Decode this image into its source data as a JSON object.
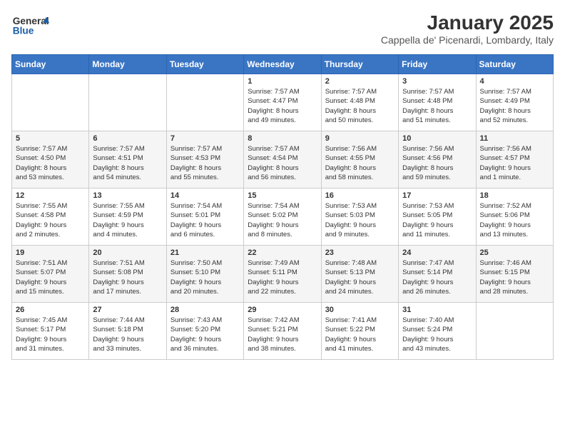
{
  "header": {
    "logo_general": "General",
    "logo_blue": "Blue",
    "title": "January 2025",
    "subtitle": "Cappella de' Picenardi, Lombardy, Italy"
  },
  "weekdays": [
    "Sunday",
    "Monday",
    "Tuesday",
    "Wednesday",
    "Thursday",
    "Friday",
    "Saturday"
  ],
  "weeks": [
    [
      {
        "day": "",
        "info": ""
      },
      {
        "day": "",
        "info": ""
      },
      {
        "day": "",
        "info": ""
      },
      {
        "day": "1",
        "info": "Sunrise: 7:57 AM\nSunset: 4:47 PM\nDaylight: 8 hours\nand 49 minutes."
      },
      {
        "day": "2",
        "info": "Sunrise: 7:57 AM\nSunset: 4:48 PM\nDaylight: 8 hours\nand 50 minutes."
      },
      {
        "day": "3",
        "info": "Sunrise: 7:57 AM\nSunset: 4:48 PM\nDaylight: 8 hours\nand 51 minutes."
      },
      {
        "day": "4",
        "info": "Sunrise: 7:57 AM\nSunset: 4:49 PM\nDaylight: 8 hours\nand 52 minutes."
      }
    ],
    [
      {
        "day": "5",
        "info": "Sunrise: 7:57 AM\nSunset: 4:50 PM\nDaylight: 8 hours\nand 53 minutes."
      },
      {
        "day": "6",
        "info": "Sunrise: 7:57 AM\nSunset: 4:51 PM\nDaylight: 8 hours\nand 54 minutes."
      },
      {
        "day": "7",
        "info": "Sunrise: 7:57 AM\nSunset: 4:53 PM\nDaylight: 8 hours\nand 55 minutes."
      },
      {
        "day": "8",
        "info": "Sunrise: 7:57 AM\nSunset: 4:54 PM\nDaylight: 8 hours\nand 56 minutes."
      },
      {
        "day": "9",
        "info": "Sunrise: 7:56 AM\nSunset: 4:55 PM\nDaylight: 8 hours\nand 58 minutes."
      },
      {
        "day": "10",
        "info": "Sunrise: 7:56 AM\nSunset: 4:56 PM\nDaylight: 8 hours\nand 59 minutes."
      },
      {
        "day": "11",
        "info": "Sunrise: 7:56 AM\nSunset: 4:57 PM\nDaylight: 9 hours\nand 1 minute."
      }
    ],
    [
      {
        "day": "12",
        "info": "Sunrise: 7:55 AM\nSunset: 4:58 PM\nDaylight: 9 hours\nand 2 minutes."
      },
      {
        "day": "13",
        "info": "Sunrise: 7:55 AM\nSunset: 4:59 PM\nDaylight: 9 hours\nand 4 minutes."
      },
      {
        "day": "14",
        "info": "Sunrise: 7:54 AM\nSunset: 5:01 PM\nDaylight: 9 hours\nand 6 minutes."
      },
      {
        "day": "15",
        "info": "Sunrise: 7:54 AM\nSunset: 5:02 PM\nDaylight: 9 hours\nand 8 minutes."
      },
      {
        "day": "16",
        "info": "Sunrise: 7:53 AM\nSunset: 5:03 PM\nDaylight: 9 hours\nand 9 minutes."
      },
      {
        "day": "17",
        "info": "Sunrise: 7:53 AM\nSunset: 5:05 PM\nDaylight: 9 hours\nand 11 minutes."
      },
      {
        "day": "18",
        "info": "Sunrise: 7:52 AM\nSunset: 5:06 PM\nDaylight: 9 hours\nand 13 minutes."
      }
    ],
    [
      {
        "day": "19",
        "info": "Sunrise: 7:51 AM\nSunset: 5:07 PM\nDaylight: 9 hours\nand 15 minutes."
      },
      {
        "day": "20",
        "info": "Sunrise: 7:51 AM\nSunset: 5:08 PM\nDaylight: 9 hours\nand 17 minutes."
      },
      {
        "day": "21",
        "info": "Sunrise: 7:50 AM\nSunset: 5:10 PM\nDaylight: 9 hours\nand 20 minutes."
      },
      {
        "day": "22",
        "info": "Sunrise: 7:49 AM\nSunset: 5:11 PM\nDaylight: 9 hours\nand 22 minutes."
      },
      {
        "day": "23",
        "info": "Sunrise: 7:48 AM\nSunset: 5:13 PM\nDaylight: 9 hours\nand 24 minutes."
      },
      {
        "day": "24",
        "info": "Sunrise: 7:47 AM\nSunset: 5:14 PM\nDaylight: 9 hours\nand 26 minutes."
      },
      {
        "day": "25",
        "info": "Sunrise: 7:46 AM\nSunset: 5:15 PM\nDaylight: 9 hours\nand 28 minutes."
      }
    ],
    [
      {
        "day": "26",
        "info": "Sunrise: 7:45 AM\nSunset: 5:17 PM\nDaylight: 9 hours\nand 31 minutes."
      },
      {
        "day": "27",
        "info": "Sunrise: 7:44 AM\nSunset: 5:18 PM\nDaylight: 9 hours\nand 33 minutes."
      },
      {
        "day": "28",
        "info": "Sunrise: 7:43 AM\nSunset: 5:20 PM\nDaylight: 9 hours\nand 36 minutes."
      },
      {
        "day": "29",
        "info": "Sunrise: 7:42 AM\nSunset: 5:21 PM\nDaylight: 9 hours\nand 38 minutes."
      },
      {
        "day": "30",
        "info": "Sunrise: 7:41 AM\nSunset: 5:22 PM\nDaylight: 9 hours\nand 41 minutes."
      },
      {
        "day": "31",
        "info": "Sunrise: 7:40 AM\nSunset: 5:24 PM\nDaylight: 9 hours\nand 43 minutes."
      },
      {
        "day": "",
        "info": ""
      }
    ]
  ]
}
